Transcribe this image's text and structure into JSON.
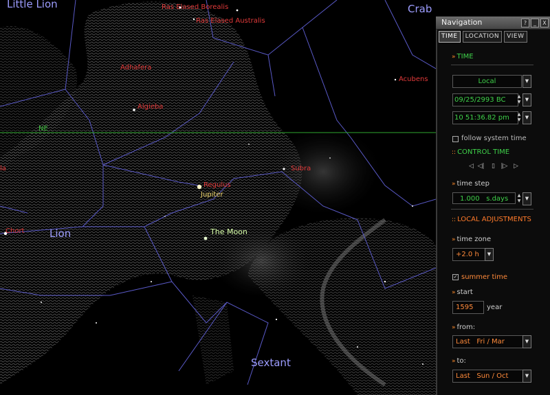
{
  "sky": {
    "constellations": [
      {
        "id": "little-lion",
        "name": "Little Lion"
      },
      {
        "id": "crab",
        "name": "Crab"
      },
      {
        "id": "lion",
        "name": "Lion"
      },
      {
        "id": "sextant",
        "name": "Sextant"
      }
    ],
    "stars": [
      {
        "id": "ras-elased-borealis",
        "name": "Ras Elased Borealis"
      },
      {
        "id": "ras-elased-australis",
        "name": "Ras Elased Australis"
      },
      {
        "id": "acubens",
        "name": "Acubens"
      },
      {
        "id": "adhafera",
        "name": "Adhafera"
      },
      {
        "id": "algieba",
        "name": "Algieba"
      },
      {
        "id": "subra",
        "name": "Subra"
      },
      {
        "id": "regulus",
        "name": "Regulus"
      },
      {
        "id": "chort",
        "name": "Chort"
      }
    ],
    "planet": "Jupiter",
    "moon": "The Moon",
    "grid_label": "NE",
    "edge_label": "la",
    "colors": {
      "constellation": "#9d9dff",
      "star": "#e23a3a",
      "planet": "#f0d66a",
      "grid": "#3fc43f",
      "lines": "#5a5ac8"
    }
  },
  "panel": {
    "title": "Navigation",
    "title_buttons": [
      "?",
      "_",
      "X"
    ],
    "tabs": [
      {
        "label": "TIME",
        "active": true
      },
      {
        "label": "LOCATION",
        "active": false
      },
      {
        "label": "VIEW",
        "active": false
      }
    ],
    "time_section": "TIME",
    "timezone_select": "Local",
    "date_value": "09/25/2993 BC",
    "time_value": "10 51:36.82 pm",
    "follow_system_time": "follow system time",
    "control_time_section": "CONTROL TIME",
    "control_icons": [
      "rewind-icon",
      "step-back-icon",
      "pause-icon",
      "step-forward-icon",
      "fast-forward-icon"
    ],
    "time_step_label": "time step",
    "time_step_value": "1.000",
    "time_step_unit": "s.days",
    "local_adjustments_section": "LOCAL ADJUSTMENTS",
    "time_zone_label": "time zone",
    "time_zone_value": "+2.0 h",
    "summer_time_label": "summer time",
    "summer_time_checked": true,
    "start_label": "start",
    "start_year_value": "1595",
    "year_label": "year",
    "from_label": "from:",
    "from_value": "Last   Fri / Mar",
    "to_label": "to:",
    "to_value": "Last   Sun / Oct",
    "colors": {
      "green": "#3fd24a",
      "orange": "#ff7a2a"
    }
  }
}
